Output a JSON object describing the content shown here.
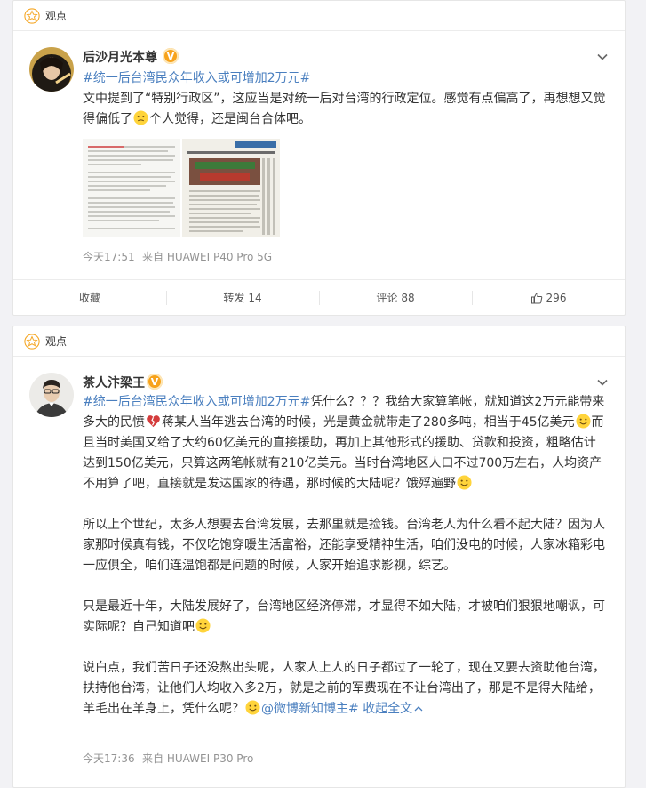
{
  "section_label": "观点",
  "post1": {
    "username": "后沙月光本尊",
    "verified_badge": "V",
    "hashtag": "#统一后台湾民众年收入或可增加2万元#",
    "text_a": "文中提到了“特别行政区”，这应当是对统一后对台湾的行政定位。感觉有点偏高了，再想想又觉得偏低了",
    "text_b": "个人觉得，还是闽台合体吧。",
    "image1_lines": [
      "【统一后台湾民众年收入或可增加2万元】11月",
      "25日《人民政协报》刊载"
    ],
    "image2_header": "海外纵横",
    "image2_title": "为什么说台湾将随被置于统一？",
    "time": "今天17:51",
    "source": "来自 HUAWEI P40 Pro 5G",
    "actions": {
      "favorite": "收藏",
      "repost_label": "转发",
      "repost_count": "14",
      "comment_label": "评论",
      "comment_count": "88",
      "like_count": "296"
    }
  },
  "post2": {
    "username": "茶人汴梁王",
    "verified_badge": "V",
    "p1_hashtag": "#统一后台湾民众年收入或可增加2万元#",
    "p1_a": "凭什么？？？我给大家算笔帐，就知道这2万元能带来多大的民愤",
    "p1_b": "蒋某人当年逃去台湾的时候，光是黄金就带走了280多吨，相当于45亿美元",
    "p1_c": "而且当时美国又给了大约60亿美元的直接援助，再加上其他形式的援助、贷款和投资，粗略估计达到150亿美元，只算这两笔帐就有210亿美元。当时台湾地区人口不过700万左右，人均资产不用算了吧，直接就是发达国家的待遇，那时候的大陆呢？饿殍遍野",
    "p2": "所以上个世纪，太多人想要去台湾发展，去那里就是捡钱。台湾老人为什么看不起大陆？因为人家那时候真有钱，不仅吃饱穿暖生活富裕，还能享受精神生活，咱们没电的时候，人家冰箱彩电一应俱全，咱们连温饱都是问题的时候，人家开始追求影视，综艺。",
    "p3": "只是最近十年，大陆发展好了，台湾地区经济停滞，才显得不如大陆，才被咱们狠狠地嘲讽，可实际呢？自己知道吧",
    "p4_a": "说白点，我们苦日子还没熬出头呢，人家人上人的日子都过了一轮了，现在又要去资助他台湾，扶持他台湾，让他们人均收入多2万，就是之前的军费现在不让台湾出了，那是不是得大陆给，羊毛出在羊身上，凭什么呢？",
    "p4_tag": "@微博新知博主#",
    "p4_collapse": "收起全文",
    "time": "今天17:36",
    "source": "来自 HUAWEI P30 Pro"
  }
}
